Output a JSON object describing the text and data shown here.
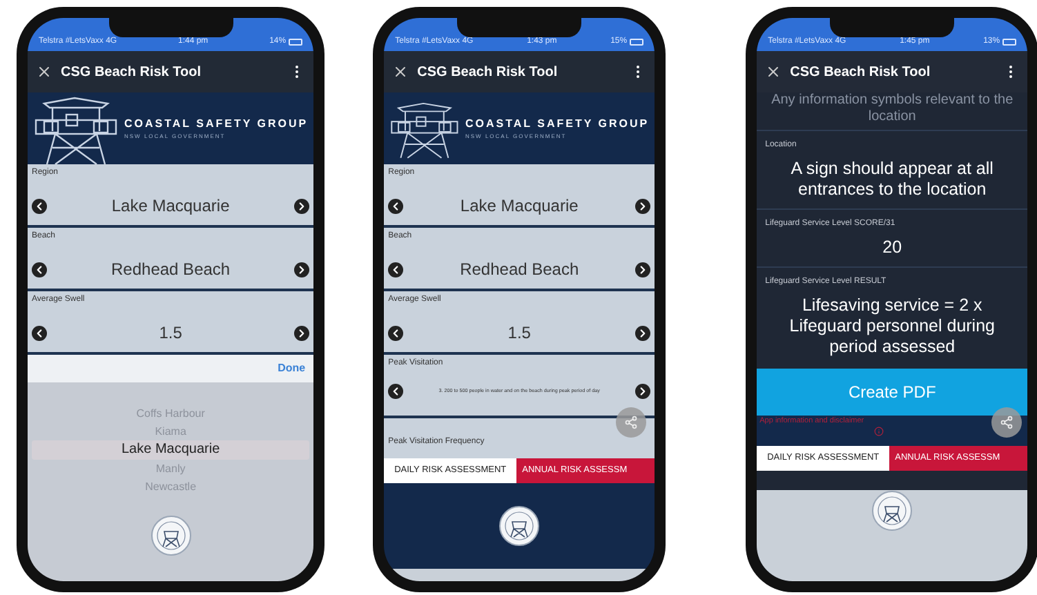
{
  "phones": [
    {
      "kind": "form",
      "status": {
        "carrier": "Telstra #LetsVaxx 4G",
        "time": "1:44 pm",
        "battery": "14%"
      },
      "title": "CSG Beach Risk Tool",
      "banner": {
        "name": "COASTAL SAFETY GROUP",
        "subtitle": "NSW LOCAL GOVERNMENT"
      },
      "fields": [
        {
          "kind": "stepper",
          "label": "Region",
          "value": "Lake Macquarie"
        },
        {
          "kind": "stepper",
          "label": "Beach",
          "value": "Redhead Beach"
        },
        {
          "kind": "stepper",
          "label": "Average Swell",
          "value": "1.5"
        }
      ],
      "picker": {
        "done": "Done",
        "options": [
          {
            "label": "Coffs Harbour",
            "selected": false
          },
          {
            "label": "Kiama",
            "selected": false
          },
          {
            "label": "Lake Macquarie",
            "selected": true
          },
          {
            "label": "Manly",
            "selected": false
          },
          {
            "label": "Newcastle",
            "selected": false
          }
        ]
      }
    },
    {
      "kind": "form",
      "status": {
        "carrier": "Telstra #LetsVaxx 4G",
        "time": "1:43 pm",
        "battery": "15%"
      },
      "title": "CSG Beach Risk Tool",
      "banner": {
        "name": "COASTAL SAFETY GROUP",
        "subtitle": "NSW LOCAL GOVERNMENT"
      },
      "fields": [
        {
          "kind": "stepper",
          "label": "Region",
          "value": "Lake Macquarie"
        },
        {
          "kind": "stepper",
          "label": "Beach",
          "value": "Redhead Beach"
        },
        {
          "kind": "stepper",
          "label": "Average Swell",
          "value": "1.5"
        },
        {
          "kind": "stepper_small",
          "label": "Peak Visitation",
          "value": "3. 200 to 500 people in water and on the beach during peak period of day"
        },
        {
          "kind": "label",
          "label": "Peak Visitation Frequency"
        }
      ],
      "tabs": [
        {
          "label": "DAILY RISK ASSESSMENT",
          "selected": true
        },
        {
          "label": "ANNUAL RISK ASSESSM",
          "selected": false
        }
      ]
    },
    {
      "kind": "result",
      "status": {
        "carrier": "Telstra #LetsVaxx 4G",
        "time": "1:45 pm",
        "battery": "13%"
      },
      "title": "CSG Beach Risk Tool",
      "overlay_text": "Any information symbols relevant to the location",
      "sections": [
        {
          "label": "Location",
          "value": "A sign should appear at all entrances to the location"
        },
        {
          "label": "Lifeguard Service Level SCORE/31",
          "value": "20"
        },
        {
          "label": "Lifeguard Service Level RESULT",
          "value": "Lifesaving service = 2 x Lifeguard personnel during period assessed"
        }
      ],
      "button": "Create PDF",
      "disclaimer": "App information and disclaimer",
      "tabs": [
        {
          "label": "DAILY RISK ASSESSMENT",
          "selected": true
        },
        {
          "label": "ANNUAL RISK ASSESSM",
          "selected": false
        }
      ]
    }
  ]
}
